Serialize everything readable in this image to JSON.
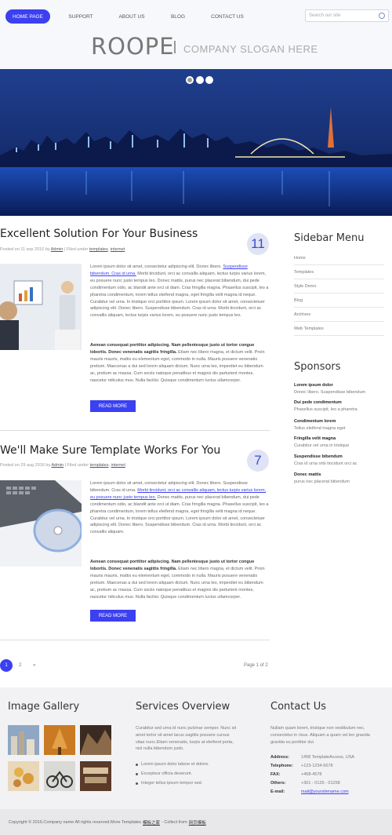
{
  "nav": {
    "items": [
      "HOME PAGE",
      "SUPPORT",
      "ABOUT US",
      "BLOG",
      "CONTACT US"
    ]
  },
  "search": {
    "placeholder": "Search our site"
  },
  "header": {
    "logo": "ROOPE",
    "slogan": "COMPANY SLOGAN HERE"
  },
  "posts": [
    {
      "title": "Excellent Solution For Your Business",
      "date_num": "11",
      "posted_on": "Posted on 11 sep 2016 by",
      "author": "Admin",
      "filed_under": "| Filed under",
      "cat1": "templates",
      "cat2": "internet",
      "para1_a": "Lorem ipsum dolor sit amet, consectetur adipiscing elit. Donec libero.",
      "para1_link": "Suspendisse bibendum. Cras id urna.",
      "para1_b": "Morbi tincidunt, orci ac convallis aliquam, lectus turpis varius lorem, eu posuere nunc justo tempus leo. Donec mattis, purus nec placerat bibendum, dui pede condimentum odio, ac blandit ante orci ut diam. Cras fringilla magna. Phasellus suscipit, leo a pharetra condimentum, lorem tellus eleifend magna, eget fringilla velit magna id neque. Curabitur vel urna. In tristique orci porttitor ipsum. Lorem ipsum dolor sit amet, consectetuer adipiscing elit. Donec libero. Suspendisse bibendum. Cras id urna. Morbi tincidunt, orci ac convallis aliquam, lectus turpis varius lorem, eu posuere nunc justo tempus leo.",
      "para2_bold": "Aenean consequat porttitor adipiscing. Nam pellentesque justo ut tortor congue lobortis. Donec venenatis sagittis fringilla.",
      "para2": "Etiam nec libero magna, et dictum velit. Proin mauris mauris, mattis eu elementum eget, commodo in nulla. Mauris posuere venenatis pretium. Maecenas a dui sed lorem aliquam dictum. Nunc urna leo, imperdiet eu bibendum ac, pretium ac massa. Cum sociis natoque penatibus et magnis dis parturient montes, nascetur ridiculus mus. Nulla facilisi. Quisque condimentum luctus ullamcorper.",
      "read_more": "READ MORE"
    },
    {
      "title": "We'll Make Sure Template Works For You",
      "date_num": "7",
      "posted_on": "Posted on 29 aug 2016 by",
      "author": "Admin",
      "filed_under": "| Filed under",
      "cat1": "templates",
      "cat2": "internet",
      "para1_a": "Lorem ipsum dolor sit amet, consectetur adipiscing elit. Donec libero. Suspendisse bibendum. Cras id urna.",
      "para1_link": "Morbi tincidunt, orci ac convallis aliquam, lectus turpis varius lorem, eu posuere nunc justo tempus leo.",
      "para1_b": "Donec mattis, purus nec placerat bibendum, dui pede condimentum odio, ac blandit ante orci ut diam. Cras fringilla magna. Phasellus suscipit, leo a pharetra condimentum, lorem tellus eleifend magna, eget fringilla velit magna id neque. Curabitur vel urna. In tristique orci porttitor ipsum. Lorem ipsum dolor sit amet, consectetuer adipiscing elit. Donec libero. Suspendisse bibendum. Cras id urna. Morbi tincidunt, orci ac convallis aliquam.",
      "para2_bold": "Aenean consequat porttitor adipiscing. Nam pellentesque justo ut tortor congue lobortis. Donec venenatis sagittis fringilla.",
      "para2": "Etiam nec libero magna, et dictum velit. Proin mauris mauris, mattis eu elementum eget, commodo in nulla. Mauris posuere venenatis pretium. Maecenas a dui sed lorem aliquam dictum. Nunc urna leo, imperdiet eu bibendum ac, pretium ac massa. Cum sociis natoque penatibus et magnis dis parturient montes, nascetur ridiculus mus. Nulla facilisi. Quisque condimentum luctus ullamcorper.",
      "read_more": "READ MORE"
    }
  ],
  "sidebar": {
    "menu_title": "Sidebar Menu",
    "menu": [
      "Home",
      "Templates",
      "Style Demo",
      "Blog",
      "Archives",
      "Web Templates"
    ],
    "sponsors_title": "Sponsors",
    "sponsors": [
      {
        "t": "Lorem ipsum dolor",
        "d": "Donec libero. Suspendisse bibendum"
      },
      {
        "t": "Dui pede condimentum",
        "d": "Phasellus suscipit, leo a pharetra"
      },
      {
        "t": "Condimentum lorem",
        "d": "Tellus eleifend magna eget"
      },
      {
        "t": "Fringilla velit magna",
        "d": "Curabitur vel urna in tristique"
      },
      {
        "t": "Suspendisse bibendum",
        "d": "Cras id urna orbi tincidunt orci ac"
      },
      {
        "t": "Donec mattis",
        "d": "purus nec placerat bibendum"
      }
    ]
  },
  "pagination": {
    "p1": "1",
    "p2": "2",
    "next": "»",
    "info": "Page 1 of 2"
  },
  "footer": {
    "gallery_title": "Image Gallery",
    "services_title": "Services Overview",
    "services_text": "Curabitur sed urna id nunc pulvinar semper. Nunc sit amet tortor sit amet lacus sagittis posuere cursus vitae nunc.Etiam venenatis, turpis at eleifend porta, nisl nulla bibendum justo.",
    "services_list": [
      "Lorem ipsum dolor labore et dolore.",
      "Excepteur officia deserunt.",
      "Integer tellus ipsum tempor sed."
    ],
    "contact_title": "Contact Us",
    "contact_text": "Nullam quam lorem, tristique non vestibulum nec, consectetur in risus. Aliquam a quam vel leo gravida gravida eu porttitor dui.",
    "contact": [
      {
        "k": "Address:",
        "v": "1458 TemplateAccess, USA"
      },
      {
        "k": "Telephone:",
        "v": "+123-1234-5678"
      },
      {
        "k": "FAX:",
        "v": "+458-4578"
      },
      {
        "k": "Others:",
        "v": "+301 - 0125 - 01258"
      },
      {
        "k": "E-mail:",
        "v": "mail@yoursitename.com"
      }
    ]
  },
  "copyright": {
    "text": "Copyright © 2016.Company name All rights reserved.More Templates",
    "link1": "模板之家",
    "mid": "- Collect from",
    "link2": "网页模板"
  },
  "colors": {
    "accent": "#3b40f0"
  }
}
